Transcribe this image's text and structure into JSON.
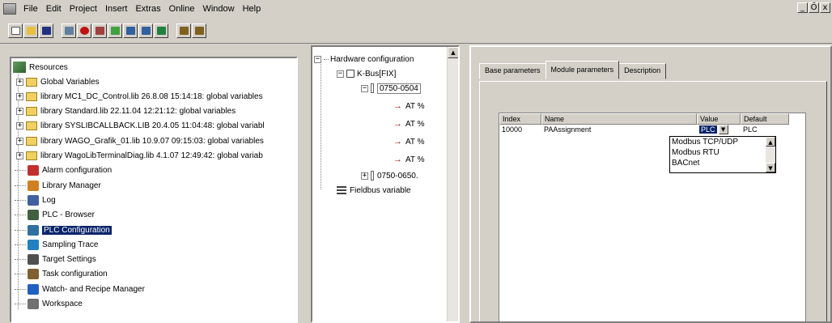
{
  "menu": [
    "File",
    "Edit",
    "Project",
    "Insert",
    "Extras",
    "Online",
    "Window",
    "Help"
  ],
  "window_controls": [
    "_",
    "Ő",
    "x"
  ],
  "resources": {
    "root": "Resources",
    "items": [
      {
        "label": "Global Variables",
        "icon": "folder-icon",
        "expandable": true
      },
      {
        "label": "library MC1_DC_Control.lib 26.8.08 15:14:18: global variables",
        "icon": "folder-icon",
        "expandable": true
      },
      {
        "label": "library Standard.lib 22.11.04 12:21:12: global variables",
        "icon": "folder-icon",
        "expandable": true
      },
      {
        "label": "library SYSLIBCALLBACK.LIB 20.4.05 11:04:48: global variabl",
        "icon": "folder-icon",
        "expandable": true
      },
      {
        "label": "library WAGO_Grafik_01.lib 10.9.07 09:15:03: global variables",
        "icon": "folder-icon",
        "expandable": true
      },
      {
        "label": "library WagoLibTerminalDiag.lib 4.1.07 12:49:42: global variab",
        "icon": "folder-icon",
        "expandable": true
      },
      {
        "label": "Alarm configuration",
        "icon": "alarm-icon"
      },
      {
        "label": "Library Manager",
        "icon": "library-icon"
      },
      {
        "label": "Log",
        "icon": "log-icon"
      },
      {
        "label": "PLC - Browser",
        "icon": "browser-icon"
      },
      {
        "label": "PLC Configuration",
        "icon": "plc-config-icon",
        "selected": true
      },
      {
        "label": "Sampling Trace",
        "icon": "trace-icon"
      },
      {
        "label": "Target Settings",
        "icon": "target-icon"
      },
      {
        "label": "Task configuration",
        "icon": "task-icon"
      },
      {
        "label": "Watch- and Recipe Manager",
        "icon": "watch-icon"
      },
      {
        "label": "Workspace",
        "icon": "workspace-icon"
      }
    ]
  },
  "hardware": {
    "root": "Hardware configuration",
    "kbus": "K-Bus[FIX]",
    "module1": "0750-0504",
    "at_items": [
      "AT %",
      "AT %",
      "AT %",
      "AT %"
    ],
    "module2": "0750-0650.",
    "fieldbus": "Fieldbus variable"
  },
  "tabs": [
    {
      "label": "Base parameters",
      "active": false
    },
    {
      "label": "Module parameters",
      "active": true
    },
    {
      "label": "Description",
      "active": false
    }
  ],
  "table": {
    "headers": [
      "Index",
      "Name",
      "Value",
      "Default"
    ],
    "row": {
      "index": "10000",
      "name": "PAAssignment",
      "value": "PLC",
      "default": "PLC"
    }
  },
  "dropdown_options": [
    "Modbus TCP/UDP",
    "Modbus RTU",
    "BACnet"
  ],
  "colors": {
    "selection": "#0a246a",
    "window_bg": "#d4d0c8"
  }
}
